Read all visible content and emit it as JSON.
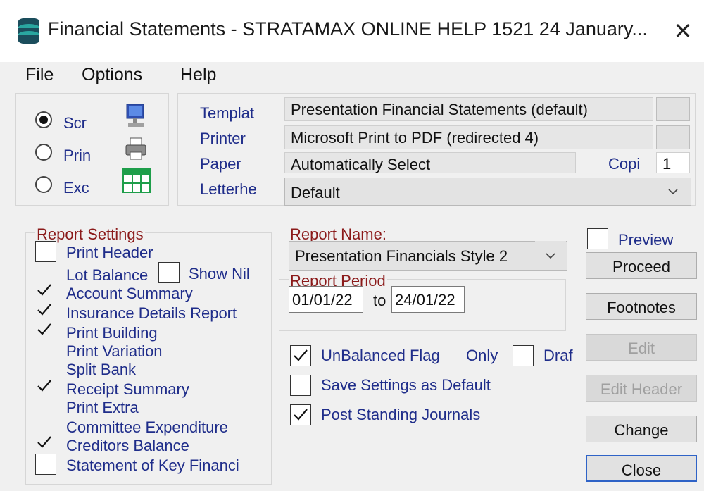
{
  "window": {
    "title": "Financial Statements - STRATAMAX ONLINE HELP 1521 24 January...",
    "close_glyph": "✕"
  },
  "menu": {
    "file": "File",
    "options": "Options",
    "help": "Help"
  },
  "output": {
    "screen_label": "Scr",
    "printer_label": "Prin",
    "excel_label": "Exc",
    "selected": "screen"
  },
  "print_setup": {
    "template_label": "Templat",
    "template_value": "Presentation Financial Statements (default)",
    "printer_label": "Printer",
    "printer_value": "Microsoft Print to PDF (redirected 4)",
    "paper_label": "Paper",
    "paper_value": "Automatically Select",
    "copies_label": "Copi",
    "copies_value": "1",
    "letterhead_label": "Letterhe",
    "letterhead_value": "Default"
  },
  "report_settings": {
    "title": "Report Settings",
    "show_nil_label": "Show Nil",
    "items": [
      {
        "label": "Print Header",
        "checked": false
      },
      {
        "label": "Lot Balance",
        "checked": false
      },
      {
        "label": "Account Summary",
        "checked": true
      },
      {
        "label": "Insurance Details Report",
        "checked": true
      },
      {
        "label": "Print Building",
        "checked": true
      },
      {
        "label": "Print Variation",
        "checked": false
      },
      {
        "label": "Split Bank",
        "checked": false
      },
      {
        "label": "Receipt Summary",
        "checked": true
      },
      {
        "label": "Print Extra",
        "checked": false
      },
      {
        "label": "Committee Expenditure",
        "checked": false
      },
      {
        "label": "Creditors Balance",
        "checked": true
      },
      {
        "label": "Statement of Key Financi",
        "checked": false
      }
    ]
  },
  "report": {
    "name_label": "Report Name:",
    "name_value": "Presentation Financials Style 2",
    "period_label": "Report Period",
    "from": "01/01/22",
    "to_label": "to",
    "to": "24/01/22"
  },
  "options": {
    "unbalanced_label": "UnBalanced Flag",
    "only_label": "Only",
    "draft_label": "Draf",
    "save_default_label": "Save Settings as Default",
    "post_journals_label": "Post Standing Journals"
  },
  "buttons": {
    "preview_label": "Preview",
    "proceed": "Proceed",
    "footnotes": "Footnotes",
    "edit": "Edit",
    "edit_header": "Edit Header",
    "change": "Change",
    "close": "Close"
  },
  "colors": {
    "label_blue": "#1f2d8a",
    "group_red": "#8b1a1a",
    "focus_blue": "#2f63c7"
  }
}
